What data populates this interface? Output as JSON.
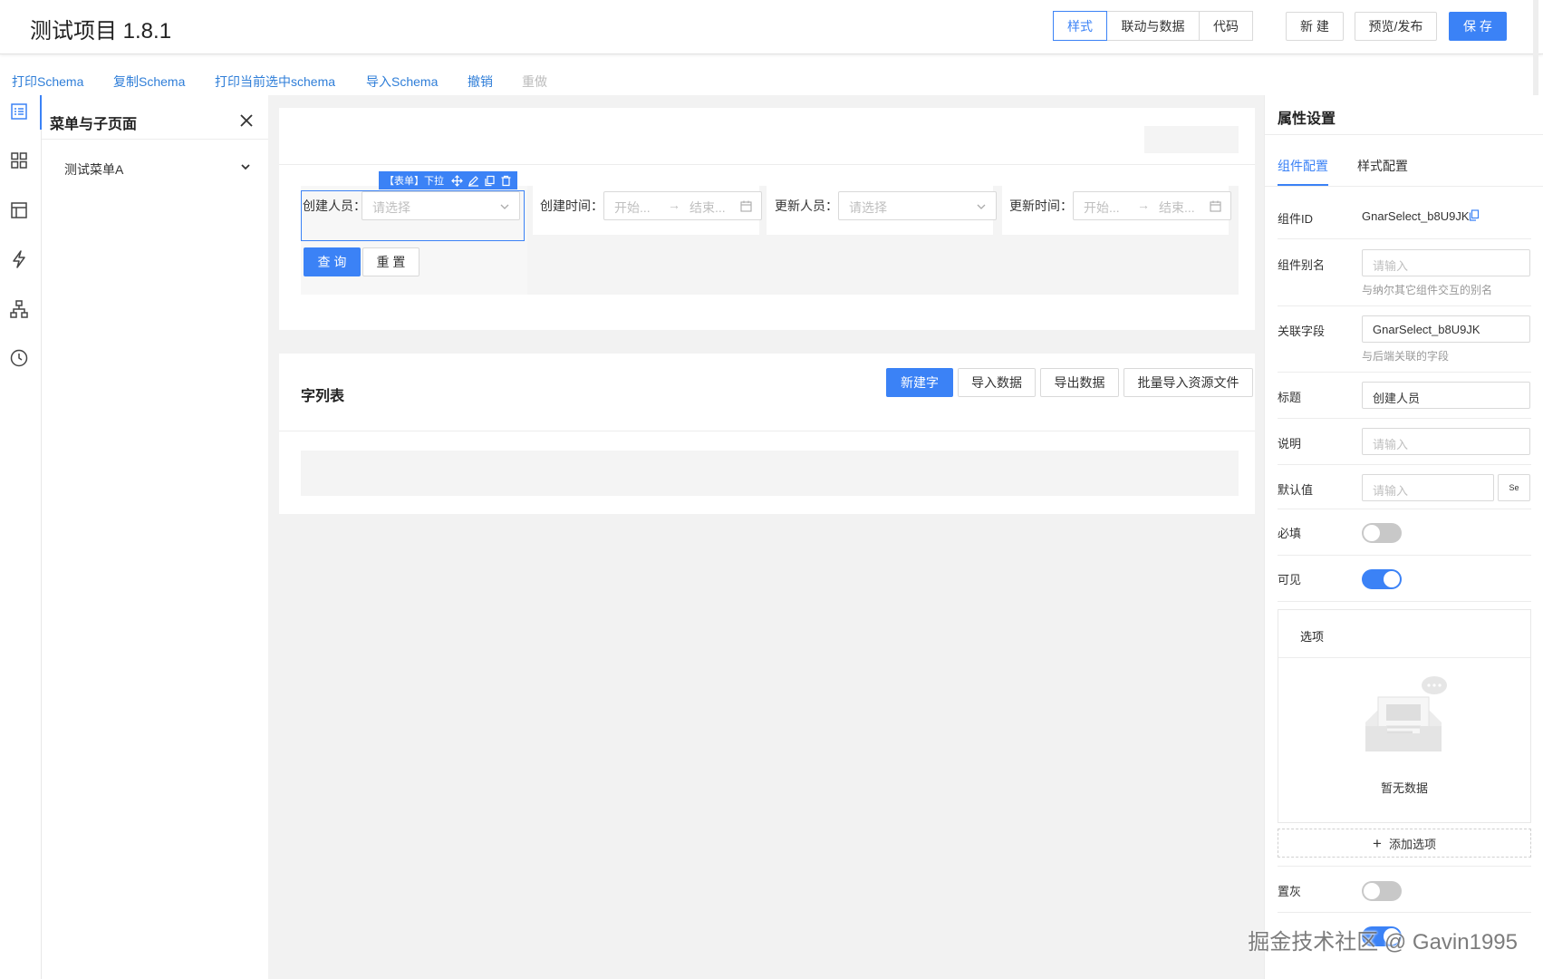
{
  "header": {
    "title": "测试项目 1.8.1",
    "tabs": [
      "样式",
      "联动与数据",
      "代码"
    ],
    "new_label": "新 建",
    "preview_label": "预览/发布",
    "save_label": "保 存"
  },
  "toolbar": {
    "print_schema": "打印Schema",
    "copy_schema": "复制Schema",
    "print_selected": "打印当前选中schema",
    "import_schema": "导入Schema",
    "undo": "撤销",
    "redo": "重做"
  },
  "sidebar_icons": [
    "list-icon",
    "grid-icon",
    "layout-icon",
    "lightning-icon",
    "sitemap-icon",
    "clock-icon"
  ],
  "menu_panel": {
    "title": "菜单与子页面",
    "items": [
      "测试菜单A"
    ]
  },
  "form": {
    "selected_tag": "【表单】下拉",
    "fields": [
      {
        "label": "创建人员：",
        "placeholder": "请选择"
      },
      {
        "label": "创建时间：",
        "start": "开始...",
        "end": "结束..."
      },
      {
        "label": "更新人员：",
        "placeholder": "请选择"
      },
      {
        "label": "更新时间：",
        "start": "开始...",
        "end": "结束..."
      }
    ],
    "query_label": "查 询",
    "reset_label": "重 置"
  },
  "list": {
    "title": "字列表",
    "new_label": "新建字",
    "import_label": "导入数据",
    "export_label": "导出数据",
    "batch_label": "批量导入资源文件"
  },
  "props": {
    "title": "属性设置",
    "tabs": [
      "组件配置",
      "样式配置"
    ],
    "component_id_label": "组件ID",
    "component_id_value": "GnarSelect_b8U9JK",
    "alias_label": "组件别名",
    "alias_placeholder": "请输入",
    "alias_hint": "与纳尔其它组件交互的别名",
    "field_label": "关联字段",
    "field_value": "GnarSelect_b8U9JK",
    "field_hint": "与后端关联的字段",
    "title_label": "标题",
    "title_value": "创建人员",
    "desc_label": "说明",
    "desc_placeholder": "请输入",
    "default_label": "默认值",
    "default_placeholder": "请输入",
    "default_btn": "Se",
    "required_label": "必填",
    "required": false,
    "visible_label": "可见",
    "visible": true,
    "options_title": "选项",
    "empty_text": "暂无数据",
    "add_option_label": "添加选项",
    "disabled_label": "置灰",
    "disabled": false
  },
  "watermark": "掘金技术社区 @ Gavin1995",
  "colors": {
    "primary": "#3b82f6",
    "link": "#2f7ed8"
  }
}
